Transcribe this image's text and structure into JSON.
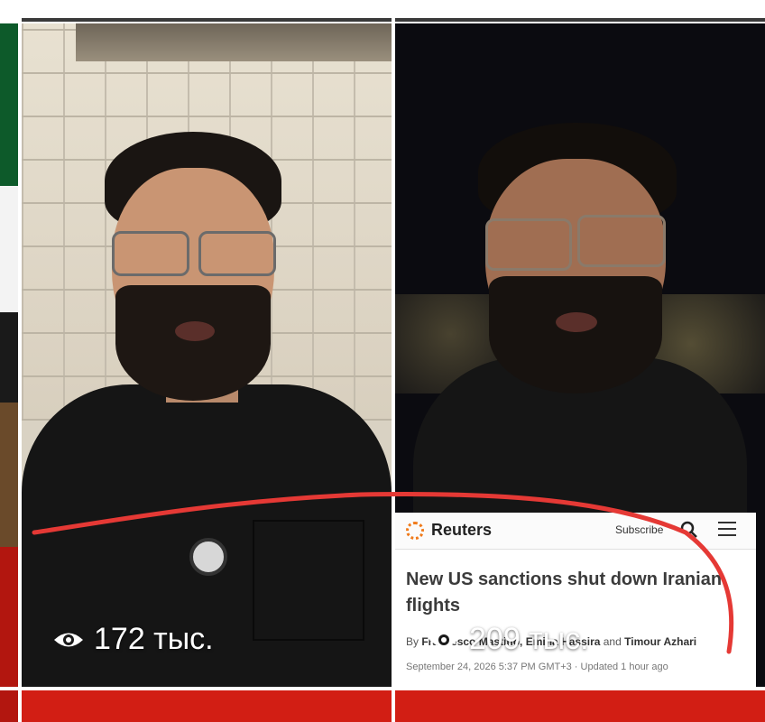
{
  "grid": {
    "tiles": [
      {
        "views_label": "172 тыс.",
        "description": "man in black shirt in front of brick wall"
      },
      {
        "views_label": "209 тыс.",
        "description": "man at night with city lights behind"
      }
    ]
  },
  "news_card": {
    "brand": "Reuters",
    "subscribe_label": "Subscribe",
    "headline": "New US sanctions shut down Iranian flights",
    "byline_prefix": "By ",
    "authors_1": "Francesco Mastino, Emina Hassira",
    "byline_and": " and ",
    "authors_2": "Timour Azhari",
    "dateline": "September 24, 2026 5:37 PM GMT+3 · Updated 1 hour ago"
  },
  "colors": {
    "annotation_red": "#e53935",
    "reuters_orange": "#f07a1a",
    "strip_red": "#d21e14"
  },
  "icons": [
    "eye-icon",
    "search-icon",
    "menu-icon",
    "reuters-logo"
  ]
}
